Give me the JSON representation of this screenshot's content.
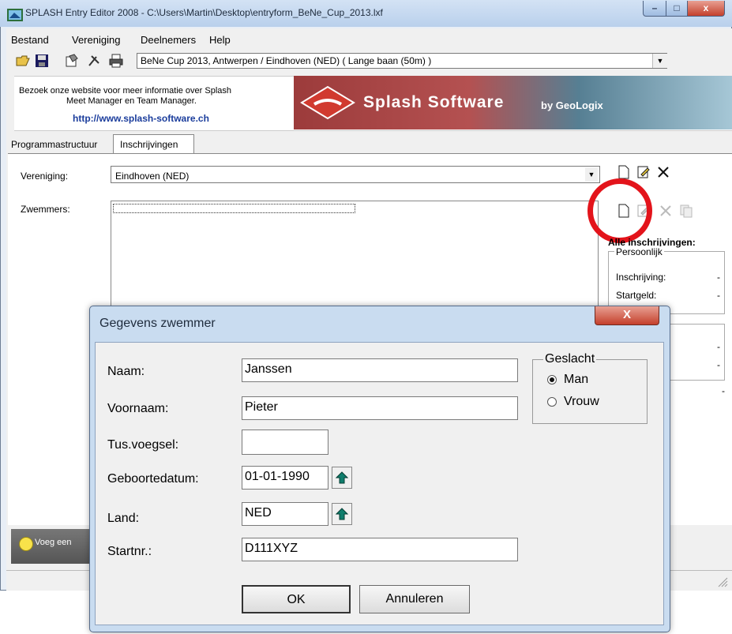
{
  "window": {
    "title": "SPLASH Entry Editor 2008 - C:\\Users\\Martin\\Desktop\\entryform_BeNe_Cup_2013.lxf",
    "minimize": "–",
    "maximize": "□",
    "close": "x"
  },
  "menu": {
    "items": [
      {
        "label": "Bestand"
      },
      {
        "label": "Vereniging"
      },
      {
        "label": "Deelnemers"
      },
      {
        "label": "Help"
      }
    ]
  },
  "toolbar": {
    "competition": "BeNe Cup 2013,  Antwerpen / Eindhoven (NED)  ( Lange baan (50m) )",
    "dropdown_arrow": "▼"
  },
  "banner": {
    "text_line1": "Bezoek onze website voor meer informatie over Splash",
    "text_line2": "Meet Manager en Team Manager.",
    "link": "http://www.splash-software.ch",
    "brand": "Splash Software",
    "by": "by GeoLogix"
  },
  "tabs": [
    {
      "label": "Programmastructuur"
    },
    {
      "label": "Inschrijvingen",
      "active": true
    }
  ],
  "entries": {
    "club_label": "Vereniging:",
    "club_value": "Eindhoven (NED)",
    "swimmers_label": "Zwemmers:",
    "dropdown_arrow": "▼",
    "all_entries_label": "Alle inschrijvingen:",
    "personal_group": "Persoonlijk",
    "entry_label": "Inschrijving:",
    "entry_value": "-",
    "fee_label": "Startgeld:",
    "fee_value": "-",
    "dash": "-"
  },
  "status": {
    "hint": "Voeg een"
  },
  "dialog": {
    "title": "Gegevens zwemmer",
    "close": "X",
    "fields": {
      "naam_label": "Naam:",
      "naam_value": "Janssen",
      "voornaam_label": "Voornaam:",
      "voornaam_value": "Pieter",
      "tussenvoegsel_label": "Tus.voegsel:",
      "tussenvoegsel_value": "",
      "geboortedatum_label": "Geboortedatum:",
      "geboortedatum_value": "01-01-1990",
      "land_label": "Land:",
      "land_value": "NED",
      "startnr_label": "Startnr.:",
      "startnr_value": "D111XYZ"
    },
    "gender": {
      "legend": "Geslacht",
      "options": [
        {
          "label": "Man",
          "selected": true
        },
        {
          "label": "Vrouw",
          "selected": false
        }
      ]
    },
    "ok": "OK",
    "cancel": "Annuleren"
  },
  "colors": {
    "highlight_circle": "#e3141b",
    "link": "#1b3d9c",
    "close_button": "#c4402c"
  }
}
